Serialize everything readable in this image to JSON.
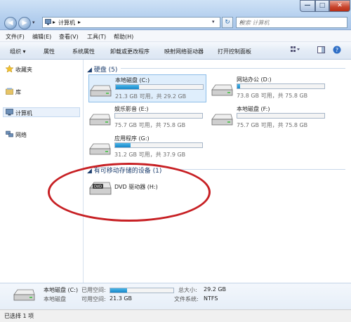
{
  "address": {
    "crumbs": [
      "计算机"
    ]
  },
  "search": {
    "placeholder": "搜索 计算机"
  },
  "menu": [
    "文件(F)",
    "编辑(E)",
    "查看(V)",
    "工具(T)",
    "帮助(H)"
  ],
  "toolbar": {
    "organize": "组织 ▾",
    "properties": "属性",
    "system_properties": "系统属性",
    "uninstall": "卸载或更改程序",
    "map_drive": "映射网络驱动器",
    "control_panel": "打开控制面板"
  },
  "sidebar": {
    "favorites": "收藏夹",
    "libraries": "库",
    "computer": "计算机",
    "network": "网络"
  },
  "groups": {
    "hard_disks": "硬盘 (5)",
    "removable": "有可移动存储的设备 (1)"
  },
  "drives": [
    {
      "name": "本地磁盘 (C:)",
      "free": "21.3 GB 可用，共 29.2 GB",
      "used_fraction": 0.27
    },
    {
      "name": "网站办公 (D:)",
      "free": "73.8 GB 可用，共 75.8 GB",
      "used_fraction": 0.03
    },
    {
      "name": "娱乐影音 (E:)",
      "free": "75.7 GB 可用，共 75.8 GB",
      "used_fraction": 0.0
    },
    {
      "name": "本地磁盘 (F:)",
      "free": "75.7 GB 可用，共 75.8 GB",
      "used_fraction": 0.0
    },
    {
      "name": "应用程序 (G:)",
      "free": "31.2 GB 可用，共 37.9 GB",
      "used_fraction": 0.18
    }
  ],
  "dvd": {
    "name": "DVD 驱动器 (H:)",
    "label": "DVD"
  },
  "details": {
    "name": "本地磁盘 (C:)",
    "type": "本地磁盘",
    "used_label": "已用空间:",
    "free_label": "可用空间:",
    "free_value": "21.3 GB",
    "total_label": "总大小:",
    "total_value": "29.2 GB",
    "fs_label": "文件系统:",
    "fs_value": "NTFS",
    "used_fraction": 0.27
  },
  "status": {
    "text": "已选择 1 项"
  },
  "colors": {
    "bar_fill": "#1787c9",
    "ellipse": "#c72024",
    "selection": "#dfeefc"
  }
}
